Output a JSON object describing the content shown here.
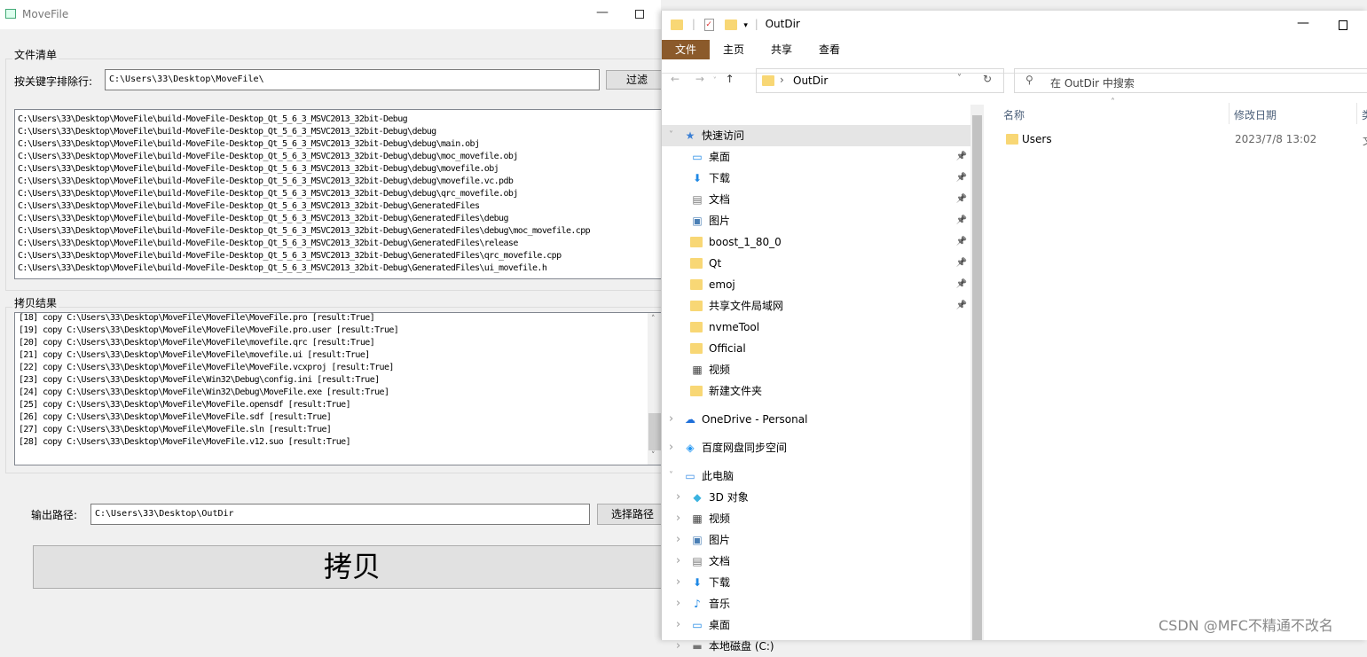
{
  "movefile": {
    "title": "MoveFile",
    "file_group": "文件清单",
    "filter_label": "按关键字排除行:",
    "filter_value": "C:\\Users\\33\\Desktop\\MoveFile\\",
    "filter_button": "过滤",
    "file_list": [
      "C:\\Users\\33\\Desktop\\MoveFile\\build-MoveFile-Desktop_Qt_5_6_3_MSVC2013_32bit-Debug",
      "C:\\Users\\33\\Desktop\\MoveFile\\build-MoveFile-Desktop_Qt_5_6_3_MSVC2013_32bit-Debug\\debug",
      "C:\\Users\\33\\Desktop\\MoveFile\\build-MoveFile-Desktop_Qt_5_6_3_MSVC2013_32bit-Debug\\debug\\main.obj",
      "C:\\Users\\33\\Desktop\\MoveFile\\build-MoveFile-Desktop_Qt_5_6_3_MSVC2013_32bit-Debug\\debug\\moc_movefile.obj",
      "C:\\Users\\33\\Desktop\\MoveFile\\build-MoveFile-Desktop_Qt_5_6_3_MSVC2013_32bit-Debug\\debug\\movefile.obj",
      "C:\\Users\\33\\Desktop\\MoveFile\\build-MoveFile-Desktop_Qt_5_6_3_MSVC2013_32bit-Debug\\debug\\movefile.vc.pdb",
      "C:\\Users\\33\\Desktop\\MoveFile\\build-MoveFile-Desktop_Qt_5_6_3_MSVC2013_32bit-Debug\\debug\\qrc_movefile.obj",
      "C:\\Users\\33\\Desktop\\MoveFile\\build-MoveFile-Desktop_Qt_5_6_3_MSVC2013_32bit-Debug\\GeneratedFiles",
      "C:\\Users\\33\\Desktop\\MoveFile\\build-MoveFile-Desktop_Qt_5_6_3_MSVC2013_32bit-Debug\\GeneratedFiles\\debug",
      "C:\\Users\\33\\Desktop\\MoveFile\\build-MoveFile-Desktop_Qt_5_6_3_MSVC2013_32bit-Debug\\GeneratedFiles\\debug\\moc_movefile.cpp",
      "C:\\Users\\33\\Desktop\\MoveFile\\build-MoveFile-Desktop_Qt_5_6_3_MSVC2013_32bit-Debug\\GeneratedFiles\\release",
      "C:\\Users\\33\\Desktop\\MoveFile\\build-MoveFile-Desktop_Qt_5_6_3_MSVC2013_32bit-Debug\\GeneratedFiles\\qrc_movefile.cpp",
      "C:\\Users\\33\\Desktop\\MoveFile\\build-MoveFile-Desktop_Qt_5_6_3_MSVC2013_32bit-Debug\\GeneratedFiles\\ui_movefile.h"
    ],
    "copy_group": "拷贝结果",
    "copy_log": [
      "[18] copy C:\\Users\\33\\Desktop\\MoveFile\\MoveFile\\MoveFile.pro [result:True]",
      "[19] copy C:\\Users\\33\\Desktop\\MoveFile\\MoveFile\\MoveFile.pro.user [result:True]",
      "[20] copy C:\\Users\\33\\Desktop\\MoveFile\\MoveFile\\movefile.qrc [result:True]",
      "[21] copy C:\\Users\\33\\Desktop\\MoveFile\\MoveFile\\movefile.ui [result:True]",
      "[22] copy C:\\Users\\33\\Desktop\\MoveFile\\MoveFile\\MoveFile.vcxproj [result:True]",
      "[23] copy C:\\Users\\33\\Desktop\\MoveFile\\Win32\\Debug\\config.ini [result:True]",
      "[24] copy C:\\Users\\33\\Desktop\\MoveFile\\Win32\\Debug\\MoveFile.exe [result:True]",
      "[25] copy C:\\Users\\33\\Desktop\\MoveFile\\MoveFile.opensdf [result:True]",
      "[26] copy C:\\Users\\33\\Desktop\\MoveFile\\MoveFile.sdf [result:True]",
      "[27] copy C:\\Users\\33\\Desktop\\MoveFile\\MoveFile.sln [result:True]",
      "[28] copy C:\\Users\\33\\Desktop\\MoveFile\\MoveFile.v12.suo [result:True]"
    ],
    "output_label": "输出路径:",
    "output_value": "C:\\Users\\33\\Desktop\\OutDir",
    "choose_button": "选择路径",
    "copy_button": "拷贝"
  },
  "explorer": {
    "title": "OutDir",
    "ribbon_tabs": [
      "文件",
      "主页",
      "共享",
      "查看"
    ],
    "ribbon_accent": "#8b5a2b",
    "address": "OutDir",
    "search_placeholder": "在 OutDir 中搜索",
    "columns": [
      "名称",
      "修改日期",
      "类"
    ],
    "files": [
      {
        "name": "Users",
        "date": "2023/7/8 13:02",
        "type": "文"
      }
    ],
    "nav": [
      {
        "label": "快速访问",
        "icon": "star-icon",
        "level": 0,
        "selected": true
      },
      {
        "label": "桌面",
        "icon": "desktop-icon",
        "level": 1,
        "pinned": true
      },
      {
        "label": "下载",
        "icon": "download-icon",
        "level": 1,
        "pinned": true
      },
      {
        "label": "文档",
        "icon": "document-icon",
        "level": 1,
        "pinned": true
      },
      {
        "label": "图片",
        "icon": "pictures-icon",
        "level": 1,
        "pinned": true
      },
      {
        "label": "boost_1_80_0",
        "icon": "folder-icon",
        "level": 1,
        "pinned": true
      },
      {
        "label": "Qt",
        "icon": "folder-icon",
        "level": 1,
        "pinned": true
      },
      {
        "label": "emoj",
        "icon": "folder-icon",
        "level": 1,
        "pinned": true
      },
      {
        "label": "共享文件局域网",
        "icon": "folder-icon",
        "level": 1,
        "pinned": true
      },
      {
        "label": "nvmeTool",
        "icon": "folder-icon",
        "level": 1
      },
      {
        "label": "Official",
        "icon": "folder-icon",
        "level": 1
      },
      {
        "label": "视频",
        "icon": "video-icon",
        "level": 1
      },
      {
        "label": "新建文件夹",
        "icon": "folder-icon",
        "level": 1
      },
      {
        "label": "OneDrive - Personal",
        "icon": "cloud-icon",
        "level": 0,
        "gap": true
      },
      {
        "label": "百度网盘同步空间",
        "icon": "baidu-icon",
        "level": 0,
        "gap": true
      },
      {
        "label": "此电脑",
        "icon": "computer-icon",
        "level": 0,
        "gap": true,
        "expanded": true
      },
      {
        "label": "3D 对象",
        "icon": "cube-icon",
        "level": 1,
        "chev": true
      },
      {
        "label": "视频",
        "icon": "video-icon",
        "level": 1,
        "chev": true
      },
      {
        "label": "图片",
        "icon": "pictures-icon",
        "level": 1,
        "chev": true
      },
      {
        "label": "文档",
        "icon": "document-icon",
        "level": 1,
        "chev": true
      },
      {
        "label": "下载",
        "icon": "download-icon",
        "level": 1,
        "chev": true
      },
      {
        "label": "音乐",
        "icon": "music-icon",
        "level": 1,
        "chev": true
      },
      {
        "label": "桌面",
        "icon": "desktop-icon",
        "level": 1,
        "chev": true
      },
      {
        "label": "本地磁盘 (C:)",
        "icon": "drive-icon",
        "level": 1,
        "chev": true
      }
    ]
  },
  "watermark": "CSDN @MFC不精通不改名"
}
